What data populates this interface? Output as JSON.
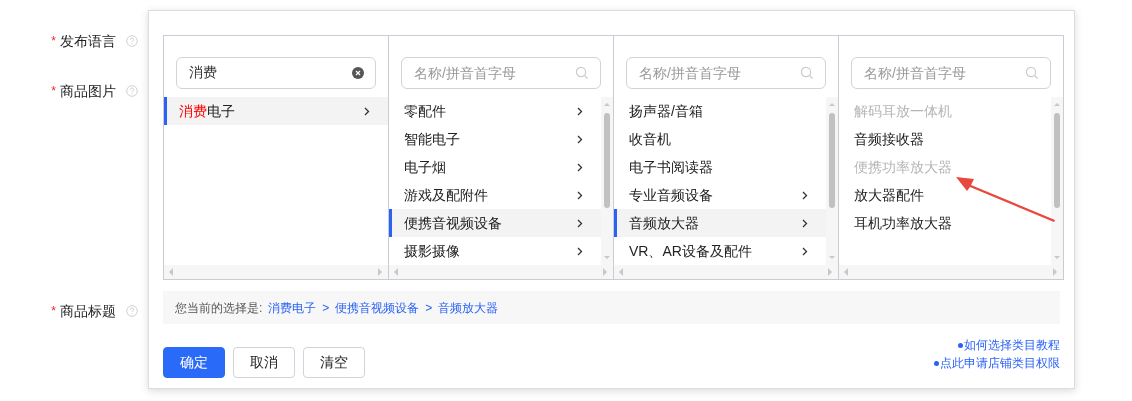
{
  "form_fields": [
    {
      "label": "发布语言",
      "required_mark": "*"
    },
    {
      "label": "商品图片",
      "required_mark": "*"
    },
    {
      "label": "商品标题",
      "required_mark": "*"
    }
  ],
  "category_picker": {
    "columns": [
      {
        "search": {
          "value": "消费"
        },
        "scrollable": false,
        "items": [
          {
            "highlight": "消费",
            "label": "电子",
            "selected": true,
            "has_children": true,
            "disabled": false
          }
        ]
      },
      {
        "search": {
          "placeholder": "名称/拼音首字母"
        },
        "scrollable": true,
        "items": [
          {
            "label": "零配件",
            "selected": false,
            "has_children": true,
            "disabled": false
          },
          {
            "label": "智能电子",
            "selected": false,
            "has_children": true,
            "disabled": false
          },
          {
            "label": "电子烟",
            "selected": false,
            "has_children": true,
            "disabled": false
          },
          {
            "label": "游戏及配附件",
            "selected": false,
            "has_children": true,
            "disabled": false
          },
          {
            "label": "便携音视频设备",
            "selected": true,
            "has_children": true,
            "disabled": false
          },
          {
            "label": "摄影摄像",
            "selected": false,
            "has_children": true,
            "disabled": false
          }
        ]
      },
      {
        "search": {
          "placeholder": "名称/拼音首字母"
        },
        "scrollable": true,
        "items": [
          {
            "label": "扬声器/音箱",
            "selected": false,
            "has_children": false,
            "disabled": false
          },
          {
            "label": "收音机",
            "selected": false,
            "has_children": false,
            "disabled": false
          },
          {
            "label": "电子书阅读器",
            "selected": false,
            "has_children": false,
            "disabled": false
          },
          {
            "label": "专业音频设备",
            "selected": false,
            "has_children": true,
            "disabled": false
          },
          {
            "label": "音频放大器",
            "selected": true,
            "has_children": true,
            "disabled": false
          },
          {
            "label": "VR、AR设备及配件",
            "selected": false,
            "has_children": true,
            "disabled": false
          }
        ]
      },
      {
        "search": {
          "placeholder": "名称/拼音首字母"
        },
        "scrollable": true,
        "items": [
          {
            "label": "解码耳放一体机",
            "selected": false,
            "has_children": false,
            "disabled": true
          },
          {
            "label": "音频接收器",
            "selected": false,
            "has_children": false,
            "disabled": false
          },
          {
            "label": "便携功率放大器",
            "selected": false,
            "has_children": false,
            "disabled": true
          },
          {
            "label": "放大器配件",
            "selected": false,
            "has_children": false,
            "disabled": false
          },
          {
            "label": "耳机功率放大器",
            "selected": false,
            "has_children": false,
            "disabled": false
          }
        ]
      }
    ],
    "selection": {
      "label": "您当前的选择是:",
      "separator": ">",
      "path": [
        "消费电子",
        "便携音视频设备",
        "音频放大器"
      ]
    },
    "buttons": [
      {
        "label": "确定",
        "kind": "primary"
      },
      {
        "label": "取消",
        "kind": "default"
      },
      {
        "label": "清空",
        "kind": "default"
      }
    ],
    "help_links": [
      "如何选择类目教程",
      "点此申请店铺类目权限"
    ]
  }
}
